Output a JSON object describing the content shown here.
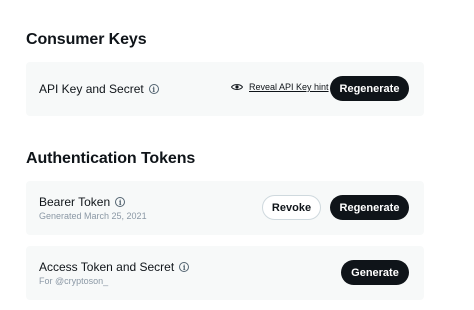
{
  "consumer_keys": {
    "title": "Consumer Keys",
    "api_key": {
      "label": "API Key and Secret",
      "info_icon": "info-icon",
      "reveal_icon": "eye-icon",
      "reveal_label": "Reveal API Key hint",
      "regenerate_label": "Regenerate"
    }
  },
  "authentication_tokens": {
    "title": "Authentication Tokens",
    "bearer_token": {
      "label": "Bearer Token",
      "info_icon": "info-icon",
      "generated": "Generated March 25, 2021",
      "revoke_label": "Revoke",
      "regenerate_label": "Regenerate"
    },
    "access_token": {
      "label": "Access Token and Secret",
      "info_icon": "info-icon",
      "for_user": "For @cryptoson_",
      "generate_label": "Generate"
    }
  },
  "colors": {
    "button_dark": "#0f1419",
    "card_background": "#f7f9f9",
    "muted_text": "#8b98a5"
  }
}
